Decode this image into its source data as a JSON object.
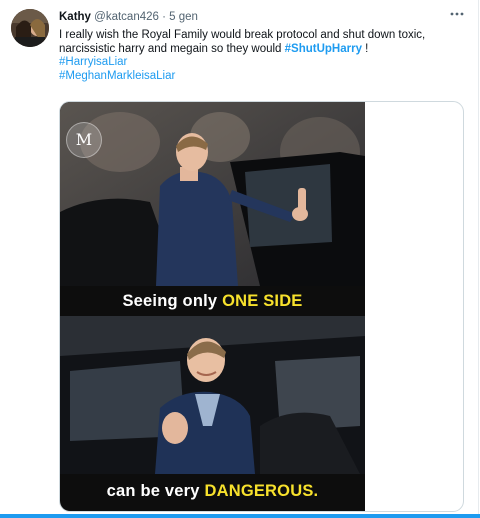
{
  "tweet": {
    "author_name": "Kathy",
    "handle": "@katcan426",
    "separator": "·",
    "time": "5 gen",
    "more_icon": "more-horizontal-icon",
    "text_line1": "I really wish the Royal Family would break protocol and shut down toxic,",
    "text_line2_pre": "narcissistic harry and megain so they would ",
    "text_line2_tag": "#ShutUpHarry",
    "text_line2_post": " !",
    "hashtag1": "#HarryisaLiar",
    "hashtag2": "#MeghanMarkleisaLiar"
  },
  "media": {
    "watermark": "M",
    "caption_top_pre": "Seeing only ",
    "caption_top_hl": "ONE SIDE",
    "caption_bottom_pre": "can be very ",
    "caption_bottom_hl": "DANGEROUS.",
    "highlight_color": "#f7e12c"
  },
  "colors": {
    "link": "#1d9bf0",
    "secondary_text": "#536471",
    "primary_text": "#0f1419"
  }
}
